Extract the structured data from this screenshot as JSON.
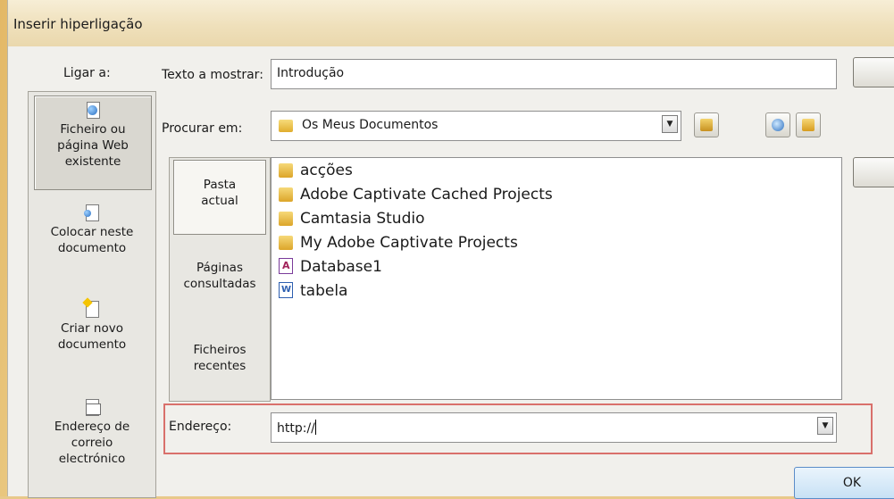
{
  "dialog": {
    "title": "Inserir hiperligação"
  },
  "nav": {
    "label": "Ligar a:",
    "items": [
      {
        "label_lines": [
          "Ficheiro ou",
          "página Web",
          "existente"
        ],
        "icon": "web-page-icon",
        "active": true
      },
      {
        "label_lines": [
          "Colocar neste",
          "documento"
        ],
        "icon": "document-place-icon",
        "active": false
      },
      {
        "label_lines": [
          "Criar novo",
          "documento"
        ],
        "icon": "new-document-icon",
        "active": false
      },
      {
        "label_lines": [
          "Endereço de",
          "correio",
          "electrónico"
        ],
        "icon": "email-icon",
        "active": false
      }
    ]
  },
  "text_to_display": {
    "label": "Texto a mostrar:",
    "value": "Introdução"
  },
  "look_in": {
    "label": "Procurar em:",
    "value": "Os Meus Documentos",
    "tools": [
      "folder-up-icon",
      "browse-web-icon",
      "browse-file-icon"
    ]
  },
  "sub_nav": {
    "items": [
      {
        "label_lines": [
          "Pasta",
          "actual"
        ],
        "active": true
      },
      {
        "label_lines": [
          "Páginas",
          "consultadas"
        ],
        "active": false
      },
      {
        "label_lines": [
          "Ficheiros",
          "recentes"
        ],
        "active": false
      }
    ]
  },
  "files": [
    {
      "name": "acções",
      "type": "folder"
    },
    {
      "name": "Adobe Captivate Cached Projects",
      "type": "folder"
    },
    {
      "name": "Camtasia Studio",
      "type": "folder"
    },
    {
      "name": "My Adobe Captivate Projects",
      "type": "folder"
    },
    {
      "name": "Database1",
      "type": "access"
    },
    {
      "name": "tabela",
      "type": "word"
    }
  ],
  "address": {
    "label": "Endereço:",
    "value": "http://"
  },
  "buttons": {
    "ok": "OK"
  },
  "colors": {
    "highlight_border": "#d9706b",
    "dialog_bg": "#f1f0ec"
  }
}
